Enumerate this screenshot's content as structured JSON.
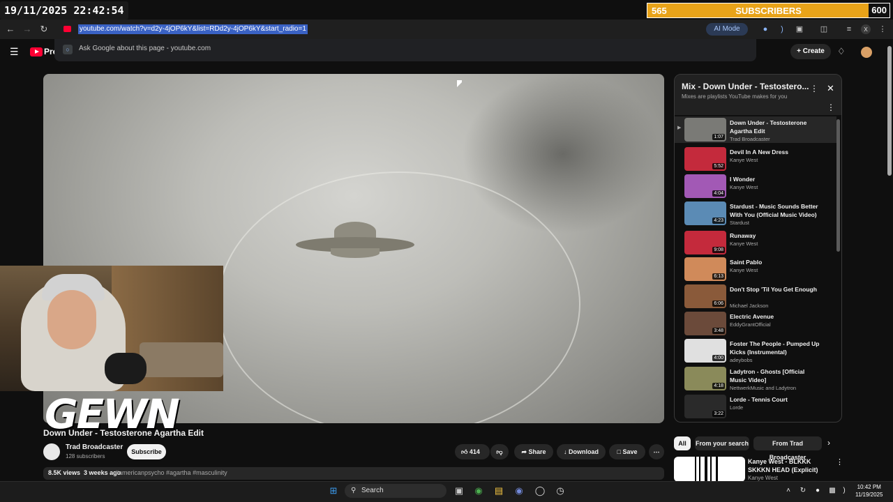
{
  "overlay": {
    "timestamp": "19/11/2025 22:42:54",
    "sub_goal": {
      "current": "565",
      "label": "SUBSCRIBERS",
      "goal": "600"
    },
    "watermark": "GEWN"
  },
  "browser": {
    "url": "youtube.com/watch?v=d2y-4jOP6kY&list=RDd2y-4jOP6kY&start_radio=1",
    "ai_mode_label": "AI Mode",
    "suggestion": "Ask Google about this page",
    "suggestion_domain": "youtube.com"
  },
  "header": {
    "logo_text": "Pre",
    "create_label": "Create"
  },
  "video": {
    "title": "Down Under - Testosterone Agartha Edit",
    "channel": "Trad Broadcaster",
    "subscribers": "128 subscribers",
    "subscribe_label": "Subscribe",
    "likes": "414",
    "share_label": "Share",
    "download_label": "Download",
    "save_label": "Save",
    "views": "8.5K views",
    "age": "3 weeks ago",
    "tags": "#americanpsycho #agartha #masculinity"
  },
  "playlist": {
    "title": "Mix - Down Under - Testostero...",
    "subtitle": "Mixes are playlists YouTube makes for you",
    "items": [
      {
        "title": "Down Under - Testosterone Agartha Edit",
        "artist": "Trad Broadcaster",
        "duration": "1:07",
        "color": "#7a7a76"
      },
      {
        "title": "Devil In A New Dress",
        "artist": "Kanye West",
        "duration": "5:52",
        "color": "#c42a3c"
      },
      {
        "title": "I Wonder",
        "artist": "Kanye West",
        "duration": "4:04",
        "color": "#a259b5"
      },
      {
        "title": "Stardust - Music Sounds Better With You (Official Music Video)",
        "artist": "Stardust",
        "duration": "4:23",
        "color": "#5b8bb5"
      },
      {
        "title": "Runaway",
        "artist": "Kanye West",
        "duration": "9:08",
        "color": "#c42a3c"
      },
      {
        "title": "Saint Pablo",
        "artist": "Kanye West",
        "duration": "6:13",
        "color": "#d08a5a"
      },
      {
        "title": "Don't Stop 'Til You Get Enough",
        "artist": "Michael Jackson",
        "duration": "6:06",
        "color": "#8a5a3a"
      },
      {
        "title": "Electric Avenue",
        "artist": "EddyGrantOfficial",
        "duration": "3:48",
        "color": "#6b4a3a"
      },
      {
        "title": "Foster The People - Pumped Up Kicks (Instrumental)",
        "artist": "adeybobs",
        "duration": "4:00",
        "color": "#e0e0e0"
      },
      {
        "title": "Ladytron - Ghosts [Official Music Video]",
        "artist": "NettwerkMusic and Ladytron",
        "duration": "4:18",
        "color": "#8a8a5a"
      },
      {
        "title": "Lorde - Tennis Court",
        "artist": "Lorde",
        "duration": "3:22",
        "color": "#2a2a2a"
      }
    ]
  },
  "chips": [
    "All",
    "From your search",
    "From Trad Broadcaster"
  ],
  "recommendation": {
    "title": "Kanye West - BLKKK SKKKN HEAD (Explicit)",
    "channel": "Kanye West"
  },
  "taskbar": {
    "search_label": "Search",
    "time": "10:42 PM",
    "date": "11/19/2025"
  },
  "colors": {
    "accent": "#e8a319",
    "youtube_red": "#ff0033",
    "url_highlight": "#3a62c4"
  }
}
